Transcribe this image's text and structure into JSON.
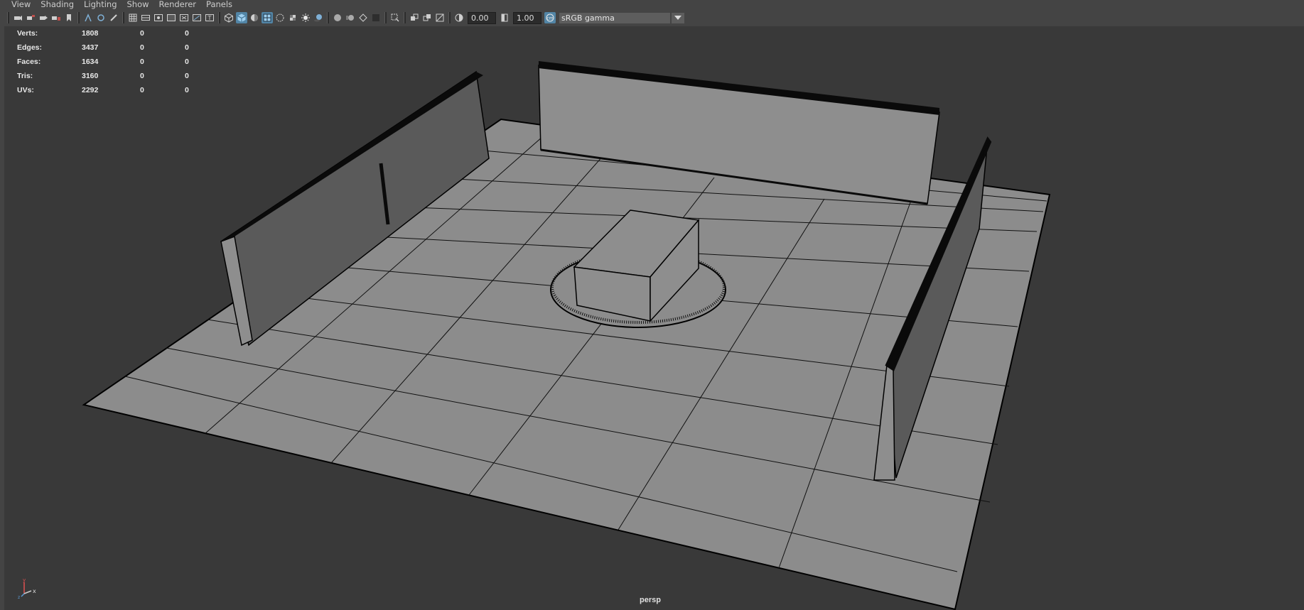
{
  "menu": [
    "View",
    "Shading",
    "Lighting",
    "Show",
    "Renderer",
    "Panels"
  ],
  "toolbar": {
    "exposure": "0.00",
    "gamma": "1.00",
    "color_space": "sRGB gamma"
  },
  "hud": {
    "rows": [
      {
        "label": "Verts:",
        "v1": "1808",
        "v2": "0",
        "v3": "0"
      },
      {
        "label": "Edges:",
        "v1": "3437",
        "v2": "0",
        "v3": "0"
      },
      {
        "label": "Faces:",
        "v1": "1634",
        "v2": "0",
        "v3": "0"
      },
      {
        "label": "Tris:",
        "v1": "3160",
        "v2": "0",
        "v3": "0"
      },
      {
        "label": "UVs:",
        "v1": "2292",
        "v2": "0",
        "v3": "0"
      }
    ]
  },
  "camera_name": "persp",
  "axis": {
    "y": "y",
    "x": "x",
    "z": "z"
  },
  "colors": {
    "accent": "#5285a6",
    "viewport_bg": "#393939",
    "floor": "#8c8c8c",
    "wall_front": "#8e8e8e",
    "wall_side": "#5a5a5a"
  }
}
